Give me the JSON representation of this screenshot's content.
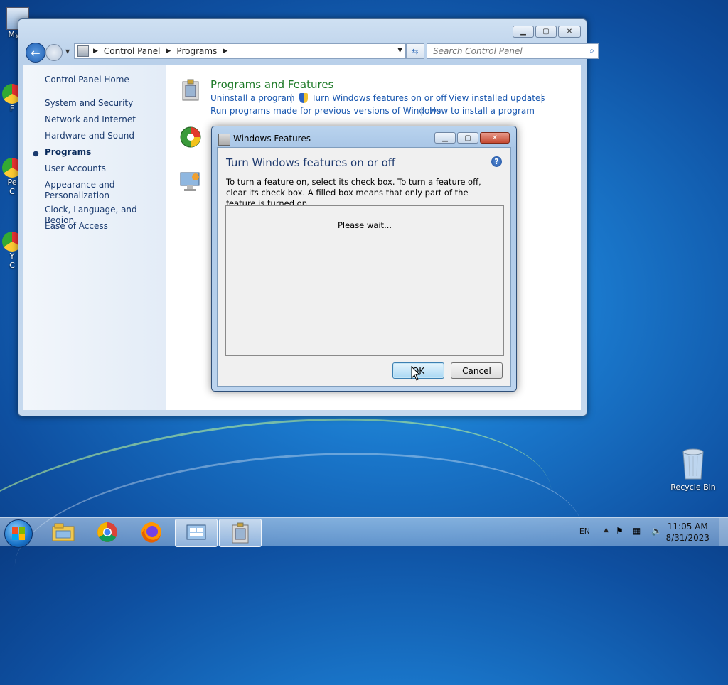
{
  "desktop": {
    "icons": [
      {
        "label": "My C"
      },
      {
        "label": "F"
      },
      {
        "label": "Pe"
      },
      {
        "label": "C"
      },
      {
        "label": "Y"
      },
      {
        "label": "C"
      }
    ],
    "recycle_bin": {
      "label": "Recycle Bin"
    }
  },
  "explorer": {
    "address": {
      "crumbs": [
        "Control Panel",
        "Programs"
      ]
    },
    "search": {
      "placeholder": "Search Control Panel"
    },
    "sidebar": {
      "home": "Control Panel Home",
      "items": [
        {
          "label": "System and Security"
        },
        {
          "label": "Network and Internet"
        },
        {
          "label": "Hardware and Sound"
        },
        {
          "label": "Programs",
          "active": true
        },
        {
          "label": "User Accounts"
        },
        {
          "label": "Appearance and",
          "label2": "Personalization"
        },
        {
          "label": "Clock, Language, and Region"
        },
        {
          "label": "Ease of Access"
        }
      ]
    },
    "programs_features": {
      "title": "Programs and Features",
      "links": [
        "Uninstall a program",
        "Turn Windows features on or off",
        "View installed updates",
        "Run programs made for previous versions of Windows",
        "How to install a program"
      ]
    }
  },
  "dialog": {
    "title": "Windows Features",
    "heading": "Turn Windows features on or off",
    "description": "To turn a feature on, select its check box. To turn a feature off, clear its check box. A filled box means that only part of the feature is turned on.",
    "status": "Please wait...",
    "ok_label": "OK",
    "cancel_label": "Cancel"
  },
  "taskbar": {
    "language": "EN",
    "time": "11:05 AM",
    "date": "8/31/2023",
    "pinned": [
      "explorer-icon",
      "chrome-icon",
      "firefox-icon",
      "control-panel-icon",
      "windows-features-icon"
    ]
  },
  "colors": {
    "link": "#1a58b0",
    "category_title": "#1e7a28",
    "heading": "#1e3a6e"
  }
}
